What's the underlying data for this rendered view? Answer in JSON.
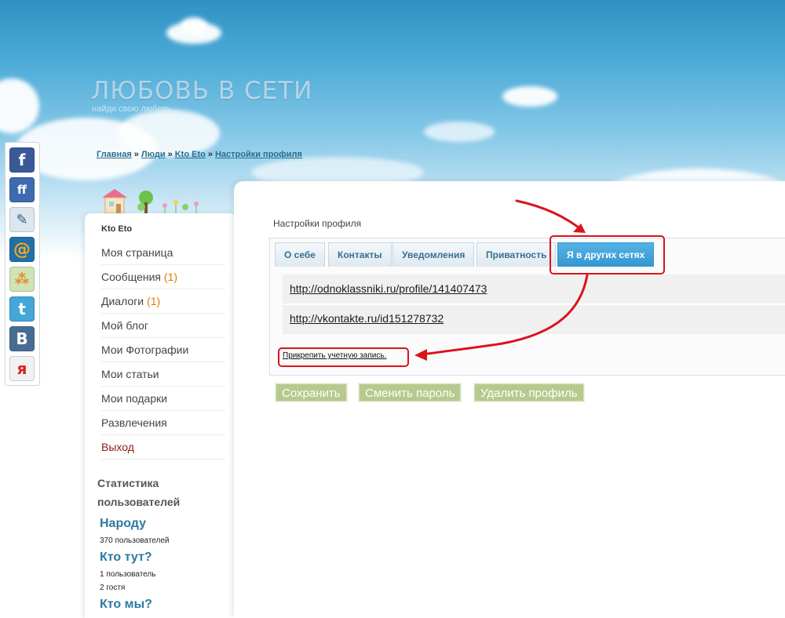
{
  "site": {
    "title": "ЛЮБОВЬ В СЕТИ",
    "slogan": "найди свою любовь..."
  },
  "breadcrumb": {
    "items": [
      "Главная",
      "Люди",
      "Kto Eto",
      "Настройки профиля"
    ],
    "separator": "»"
  },
  "social": [
    {
      "name": "facebook-icon",
      "glyph": "f",
      "color": "#3b5998"
    },
    {
      "name": "friendfeed-icon",
      "glyph": "ff",
      "color": "#3d6ab0"
    },
    {
      "name": "livejournal-icon",
      "glyph": "✎",
      "color": "#dce6ef"
    },
    {
      "name": "mailru-icon",
      "glyph": "@",
      "color": "#1f70a8"
    },
    {
      "name": "moikrug-icon",
      "glyph": "⁂",
      "color": "#cfe3b5"
    },
    {
      "name": "twitter-icon",
      "glyph": "t",
      "color": "#45a6d8"
    },
    {
      "name": "vkontakte-icon",
      "glyph": "B",
      "color": "#476c93"
    },
    {
      "name": "yaru-icon",
      "glyph": "я",
      "color": "#f1f1f1"
    }
  ],
  "sidebar": {
    "user_name": "Kto Eto",
    "menu": [
      {
        "label": "Моя страница",
        "count": ""
      },
      {
        "label": "Сообщения",
        "count": "(1)"
      },
      {
        "label": "Диалоги",
        "count": "(1)"
      },
      {
        "label": "Мой блог",
        "count": ""
      },
      {
        "label": "Мои Фотографии",
        "count": ""
      },
      {
        "label": "Мои статьи",
        "count": ""
      },
      {
        "label": "Мои подарки",
        "count": ""
      },
      {
        "label": "Развлечения",
        "count": ""
      },
      {
        "label": "Выход",
        "count": ""
      }
    ],
    "stats": {
      "title": "Статистика пользователей",
      "total_heading": "Народу",
      "total_text": "370 пользователей",
      "online_heading": "Кто тут?",
      "online_users": "1 пользователь",
      "online_guests": "2 гостя",
      "about_heading": "Кто мы?"
    }
  },
  "main": {
    "title": "Настройки профиля",
    "tabs": [
      "О себе",
      "Контакты",
      "Уведомления",
      "Приватность",
      "Я в других сетях"
    ],
    "active_tab": 4,
    "links": [
      "http://odnoklassniki.ru/profile/141407473",
      "http://vkontakte.ru/id151278732"
    ],
    "attach_label": "Прикрепить учетную запись.",
    "buttons": {
      "save": "Сохранить",
      "change_password": "Сменить пароль",
      "delete_profile": "Удалить профиль"
    }
  },
  "colors": {
    "annotation": "#d9141b",
    "active_tab": "#3597d1",
    "button": "#b7c98e"
  }
}
